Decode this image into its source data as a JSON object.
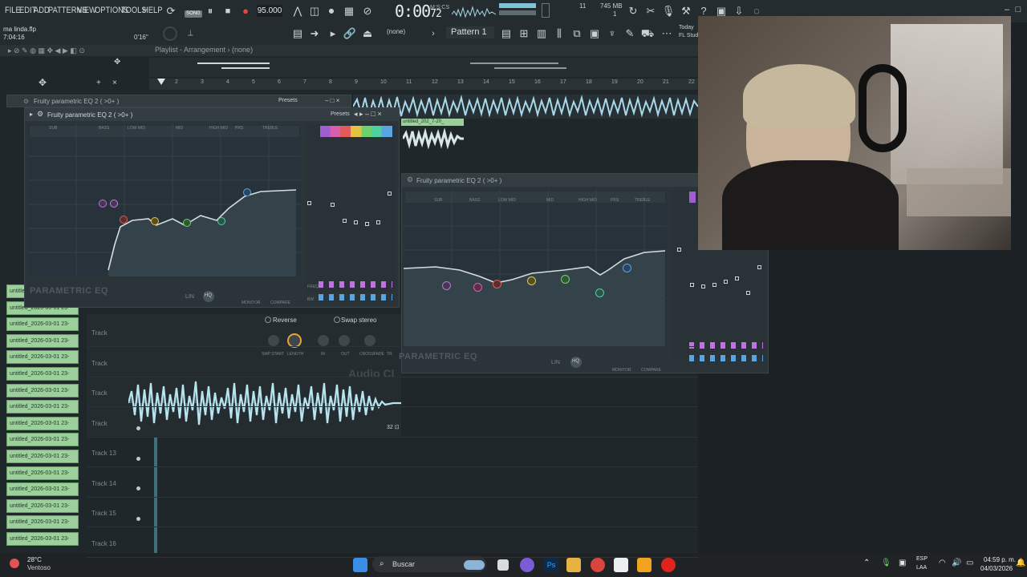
{
  "menu": [
    "FILE",
    "EDIT",
    "ADD",
    "PATTERNS",
    "VIEW",
    "OPTIONS",
    "TOOLS",
    "HELP"
  ],
  "transport": {
    "song_label": "SONG",
    "tempo": "95.000",
    "time": "0:00",
    "time_sub": "M:S:CS",
    "time_frac": "72",
    "cpu": "11",
    "mem": "745 MB",
    "mem2": "1"
  },
  "toolbar2": {
    "project": "ma linda.flp",
    "project_time": "7:04:16",
    "pos": "0'16\"",
    "none": "(none)",
    "pattern": "Pattern 1",
    "today": "Today",
    "fl": "FL Stud"
  },
  "playlist": {
    "title": "Playlist - Arrangement",
    "pattern_sel": "(none)",
    "ruler": [
      "2",
      "3",
      "4",
      "5",
      "6",
      "7",
      "8",
      "9",
      "10",
      "11",
      "12",
      "13",
      "14",
      "15",
      "16",
      "17",
      "18",
      "19",
      "20",
      "21",
      "22"
    ],
    "tracks": [
      "Track",
      "Track",
      "Track",
      "Track",
      "Track 13",
      "Track 14",
      "Track 15",
      "Track 16"
    ]
  },
  "patterns": [
    "untitled_2026-03-01 23-",
    "untitled_2026-03-01 23-",
    "untitled_2026-03-01 23-",
    "untitled_2026-03-01 23-",
    "untitled_2026-03-01 23-",
    "untitled_2026-03-01 23-",
    "untitled_2026-03-01 23-",
    "untitled_2026-03-01 23-",
    "untitled_2026-03-01 23-",
    "untitled_2026-03-01 23-",
    "untitled_2026-03-01 23-",
    "untitled_2026-03-01 23-",
    "untitled_2026-03-01 23-",
    "untitled_2026-03-01 23-",
    "untitled_2026-03-01 23-",
    "untitled_2026-03-01 23-"
  ],
  "clip_name": "untitled_202_7-20_",
  "eq1": {
    "title_back": "Fruity parametric EQ 2 ( >0+ )",
    "title": "Fruity parametric EQ 2 ( >0+ )",
    "presets": "Presets",
    "brand": "PARAMETRIC EQ",
    "bands": [
      "SUB",
      "BASS",
      "LOW MID",
      "MID",
      "HIGH MID",
      "PRS",
      "TREBLE"
    ],
    "monitor": "MONITOR",
    "compare": "COMPARE",
    "lin": "LIN",
    "hq": "HQ",
    "freq": "FREQ",
    "bw": "BW"
  },
  "eq2": {
    "title": "Fruity parametric EQ 2 ( >0+ )",
    "brand": "PARAMETRIC EQ",
    "bands": [
      "SUB",
      "BASS",
      "LOW MID",
      "MID",
      "HIGH MID",
      "PRS",
      "TREBLE"
    ],
    "monitor": "MONITOR",
    "compare": "COMPARE",
    "lin": "LIN",
    "hq": "HQ"
  },
  "audio_clip": {
    "reverse": "Reverse",
    "swap": "Swap stereo",
    "knobs": [
      "SMP START",
      "LENGTH",
      "IN",
      "OUT",
      "CROSSFADE",
      "TR"
    ],
    "brand": "Audio Cl",
    "zoom": "32"
  },
  "taskbar": {
    "temp": "28°C",
    "cond": "Ventoso",
    "search": "Buscar",
    "lang1": "ESP",
    "lang2": "LAA",
    "clock": "04:59 p. m.",
    "date": "04/03/2026"
  }
}
